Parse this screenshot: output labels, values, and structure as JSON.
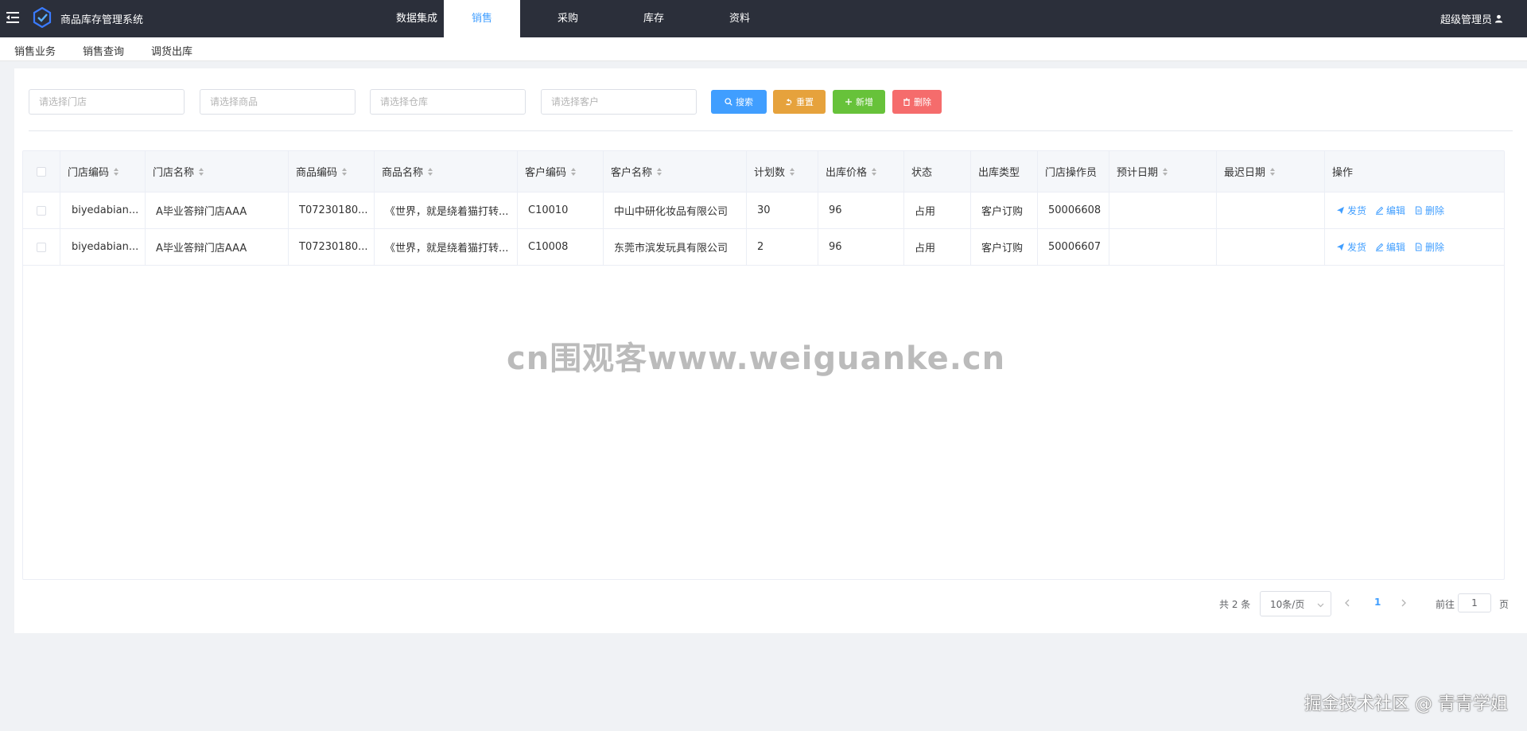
{
  "app": {
    "title": "商品库存管理系统",
    "user": "超级管理员"
  },
  "nav": {
    "tabs": [
      {
        "label": "数据集成",
        "active": false
      },
      {
        "label": "销售",
        "active": true
      },
      {
        "label": "采购",
        "active": false
      },
      {
        "label": "库存",
        "active": false
      },
      {
        "label": "资料",
        "active": false
      }
    ]
  },
  "subnav": {
    "items": [
      "销售业务",
      "销售查询",
      "调货出库"
    ]
  },
  "filters": {
    "store_placeholder": "请选择门店",
    "product_placeholder": "请选择商品",
    "warehouse_placeholder": "请选择仓库",
    "customer_placeholder": "请选择客户"
  },
  "toolbar": {
    "search_label": "搜索",
    "reset_label": "重置",
    "add_label": "新增",
    "delete_label": "删除"
  },
  "table": {
    "columns": [
      "门店编码",
      "门店名称",
      "商品编码",
      "商品名称",
      "客户编码",
      "客户名称",
      "计划数",
      "出库价格",
      "状态",
      "出库类型",
      "门店操作员",
      "预计日期",
      "最迟日期",
      "操作"
    ],
    "rows": [
      {
        "store_code": "biyedabian...",
        "store_name": "A毕业答辩门店AAA",
        "product_code": "T07230180...",
        "product_name": "《世界，就是绕着猫打转...",
        "customer_code": "C10010",
        "customer_name": "中山中研化妆品有限公司",
        "planned_qty": "30",
        "price": "96",
        "status": "占用",
        "out_type": "客户订购",
        "operator": "50006608",
        "expected_date": "",
        "latest_date": ""
      },
      {
        "store_code": "biyedabian...",
        "store_name": "A毕业答辩门店AAA",
        "product_code": "T07230180...",
        "product_name": "《世界，就是绕着猫打转...",
        "customer_code": "C10008",
        "customer_name": "东莞市滨发玩具有限公司",
        "planned_qty": "2",
        "price": "96",
        "status": "占用",
        "out_type": "客户订购",
        "operator": "50006607",
        "expected_date": "",
        "latest_date": ""
      }
    ],
    "actions": {
      "ship": "发货",
      "edit": "编辑",
      "delete": "删除"
    }
  },
  "pagination": {
    "total_text": "共 2 条",
    "page_size": "10条/页",
    "current_page": "1",
    "goto_label": "前往",
    "goto_value": "1",
    "page_suffix": "页"
  },
  "watermarks": {
    "center": "cn围观客www.weiguanke.cn",
    "corner": "掘金技术社区 @ 青青学姐"
  },
  "colors": {
    "topbar": "#2b2f3a",
    "primary": "#409eff",
    "warning": "#e6a23c",
    "success": "#67c23a",
    "danger": "#f56c6c"
  }
}
